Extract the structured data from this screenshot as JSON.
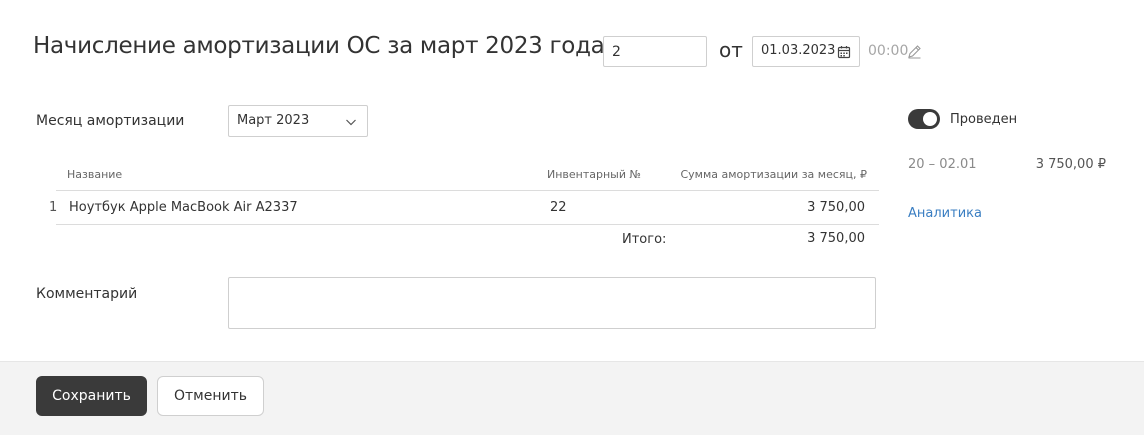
{
  "header": {
    "title": "Начисление амортизации ОС за март 2023 года №",
    "number_value": "2",
    "from_label": "от",
    "date_value": "01.03.2023",
    "time_value": "00:00",
    "icons": {
      "date": "calendar-icon",
      "time": "pencil-icon"
    }
  },
  "form": {
    "month_label": "Месяц амортизации",
    "month_value": "Март 2023",
    "comment_label": "Комментарий",
    "comment_value": ""
  },
  "table": {
    "columns": [
      "Название",
      "Инвентарный №",
      "Сумма амортизации за месяц, ₽"
    ],
    "rows": [
      {
        "index": "1",
        "name": "Ноутбук Apple MacBook Air A2337",
        "inventory": "22",
        "sum": "3 750,00"
      }
    ],
    "total_label": "Итого:",
    "total_value": "3 750,00"
  },
  "side": {
    "posted_label": "Проведен",
    "posted_on": true,
    "account": "20 – 02.01",
    "account_sum": "3 750,00 ₽",
    "analytics_link": "Аналитика"
  },
  "footer": {
    "save_label": "Сохранить",
    "cancel_label": "Отменить"
  },
  "colors": {
    "accent_dark": "#3a3a3a",
    "link": "#3a7ec2",
    "footer_bg": "#f3f3f3"
  }
}
